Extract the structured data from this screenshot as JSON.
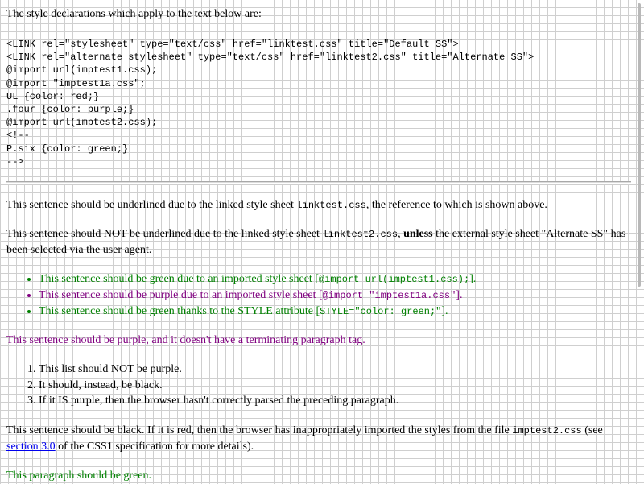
{
  "intro": "The style declarations which apply to the text below are:",
  "code_lines": [
    "<LINK rel=\"stylesheet\" type=\"text/css\" href=\"linktest.css\" title=\"Default SS\">",
    "<LINK rel=\"alternate stylesheet\" type=\"text/css\" href=\"linktest2.css\" title=\"Alternate SS\">",
    "@import url(imptest1.css);",
    "@import \"imptest1a.css\";",
    "UL {color: red;}",
    ".four {color: purple;}",
    "@import url(imptest2.css);",
    "<!--",
    "P.six {color: green;}",
    "-->"
  ],
  "underlined_para": {
    "before": "This sentence should be underlined due to the linked style sheet ",
    "code": "linktest.css",
    "after": ", the reference to which is shown above."
  },
  "not_underlined_para": {
    "before": "This sentence should NOT be underlined due to the linked style sheet ",
    "code": "linktest2.css",
    "comma": ", ",
    "bold": "unless",
    "after": " the external style sheet \"Alternate SS\" has been selected via the user agent."
  },
  "import_items": [
    {
      "text": "This sentence should be green due to an imported style sheet [",
      "code": "@import url(imptest1.css);",
      "end": "]."
    },
    {
      "text": "This sentence should be purple due to an imported style sheet [",
      "code": "@import \"imptest1a.css\"",
      "end": "]."
    },
    {
      "text": "This sentence should be green thanks to the STYLE attribute [",
      "code": "STYLE=\"color: green;\"",
      "end": "]."
    }
  ],
  "purple_para": "This sentence should be purple, and it doesn't have a terminating paragraph tag.",
  "ordered_items": [
    "This list should NOT be purple.",
    "It should, instead, be black.",
    "If it IS purple, then the browser hasn't correctly parsed the preceding paragraph."
  ],
  "black_para": {
    "before": "This sentence should be black. If it is red, then the browser has inappropriately imported the styles from the file ",
    "code": "imptest2.css",
    "middle": " (see ",
    "link": "section 3.0",
    "after": " of the CSS1 specification for more details)."
  },
  "green_para": "This paragraph should be green.",
  "colors": {
    "green": "#008000",
    "purple": "#800080",
    "red": "#ff0000",
    "link": "#0000ee"
  }
}
